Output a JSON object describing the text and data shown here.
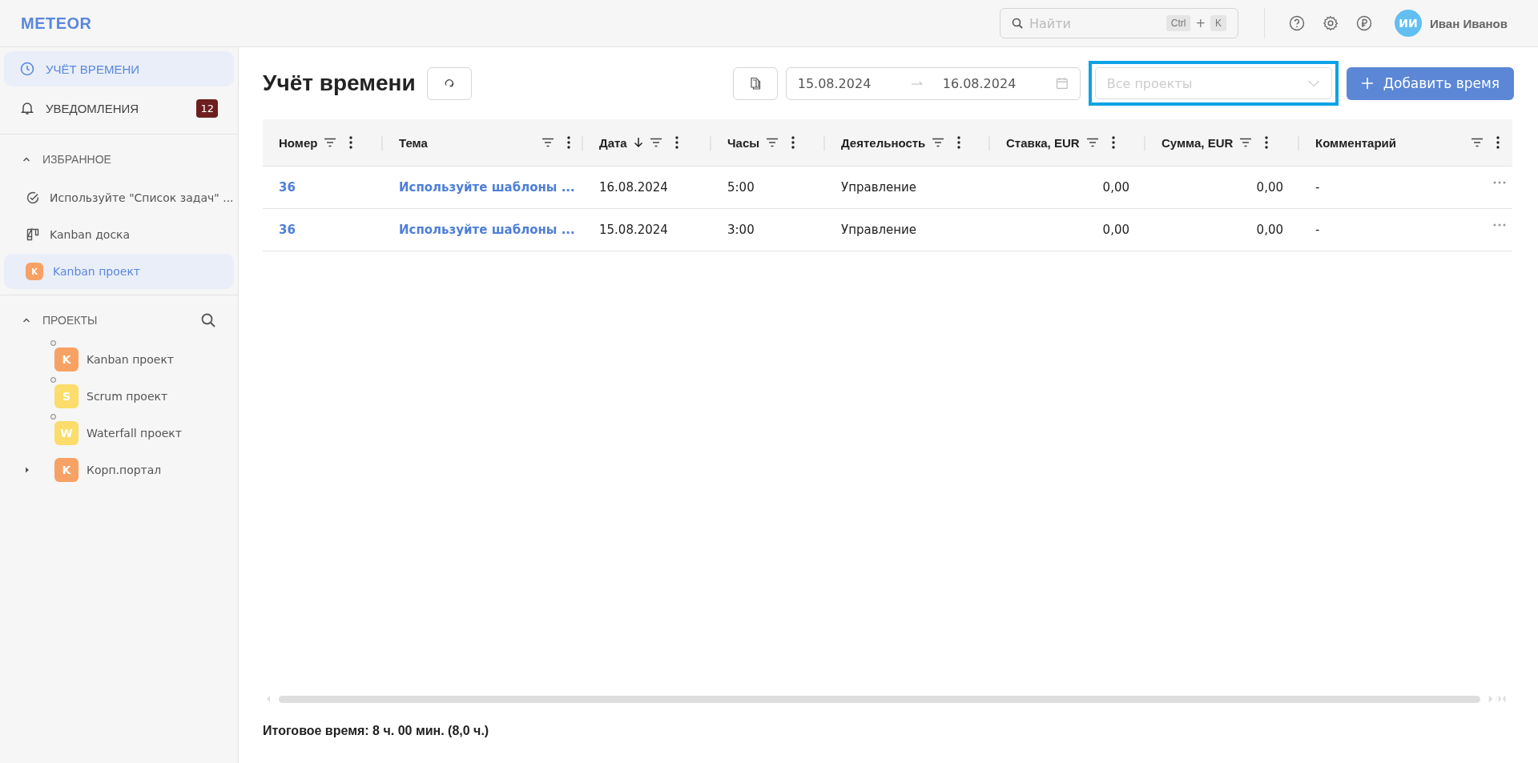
{
  "header": {
    "logo": "METEOR",
    "search": {
      "placeholder": "Найти",
      "shortcut": [
        "Ctrl",
        "+",
        "K"
      ]
    },
    "user": {
      "initials": "ИИ",
      "name": "Иван Иванов"
    }
  },
  "sidebar": {
    "nav": [
      {
        "label": "УЧЁТ ВРЕМЕНИ",
        "selected": true
      },
      {
        "label": "УВЕДОМЛЕНИЯ",
        "selected": false,
        "badge": "12"
      }
    ],
    "favorites": {
      "title": "ИЗБРАННОЕ",
      "expanded": true,
      "items": [
        {
          "kind": "check",
          "label": "Используйте \"Список задач\" ...",
          "selected": false
        },
        {
          "kind": "board",
          "label": "Kanban доска",
          "selected": false
        },
        {
          "kind": "avatar",
          "letter": "K",
          "color": "#f8a164",
          "label": "Kanban проект",
          "selected": true
        }
      ]
    },
    "projects": {
      "title": "ПРОЕКТЫ",
      "expanded": true,
      "items": [
        {
          "kind": "pinned",
          "letter": "K",
          "color": "#f8a164",
          "label": "Kanban проект"
        },
        {
          "kind": "pinned",
          "letter": "S",
          "color": "#fcdc6a",
          "label": "Scrum проект"
        },
        {
          "kind": "pinned",
          "letter": "W",
          "color": "#fcdc6a",
          "label": "Waterfall проект"
        },
        {
          "kind": "folder",
          "letter": "K",
          "color": "#f8a164",
          "label": "Корп.портал",
          "expanded": false
        }
      ]
    }
  },
  "page": {
    "title": "Учёт времени",
    "date_from": "15.08.2024",
    "date_to": "16.08.2024",
    "project_select": {
      "placeholder": "Все проекты",
      "focused": true
    },
    "add_button": "Добавить время"
  },
  "table": {
    "columns": [
      {
        "label": "Номер",
        "kind": "link",
        "sorted": false
      },
      {
        "label": "Тема",
        "kind": "link",
        "sorted": false
      },
      {
        "label": "Дата",
        "kind": "text",
        "sorted": true
      },
      {
        "label": "Часы",
        "kind": "text",
        "sorted": false
      },
      {
        "label": "Деятельность",
        "kind": "text",
        "sorted": false
      },
      {
        "label": "Ставка, EUR",
        "kind": "number",
        "sorted": false
      },
      {
        "label": "Сумма, EUR",
        "kind": "number",
        "sorted": false
      },
      {
        "label": "Комментарий",
        "kind": "text",
        "sorted": false
      }
    ],
    "rows": [
      [
        "36",
        "Используйте шаблоны ...",
        "16.08.2024",
        "5:00",
        "Управление",
        "0,00",
        "0,00",
        "-"
      ],
      [
        "36",
        "Используйте шаблоны ...",
        "15.08.2024",
        "3:00",
        "Управление",
        "0,00",
        "0,00",
        "-"
      ]
    ]
  },
  "footer": {
    "total": "Итоговое время: 8 ч. 00 мин. (8,0 ч.)"
  }
}
